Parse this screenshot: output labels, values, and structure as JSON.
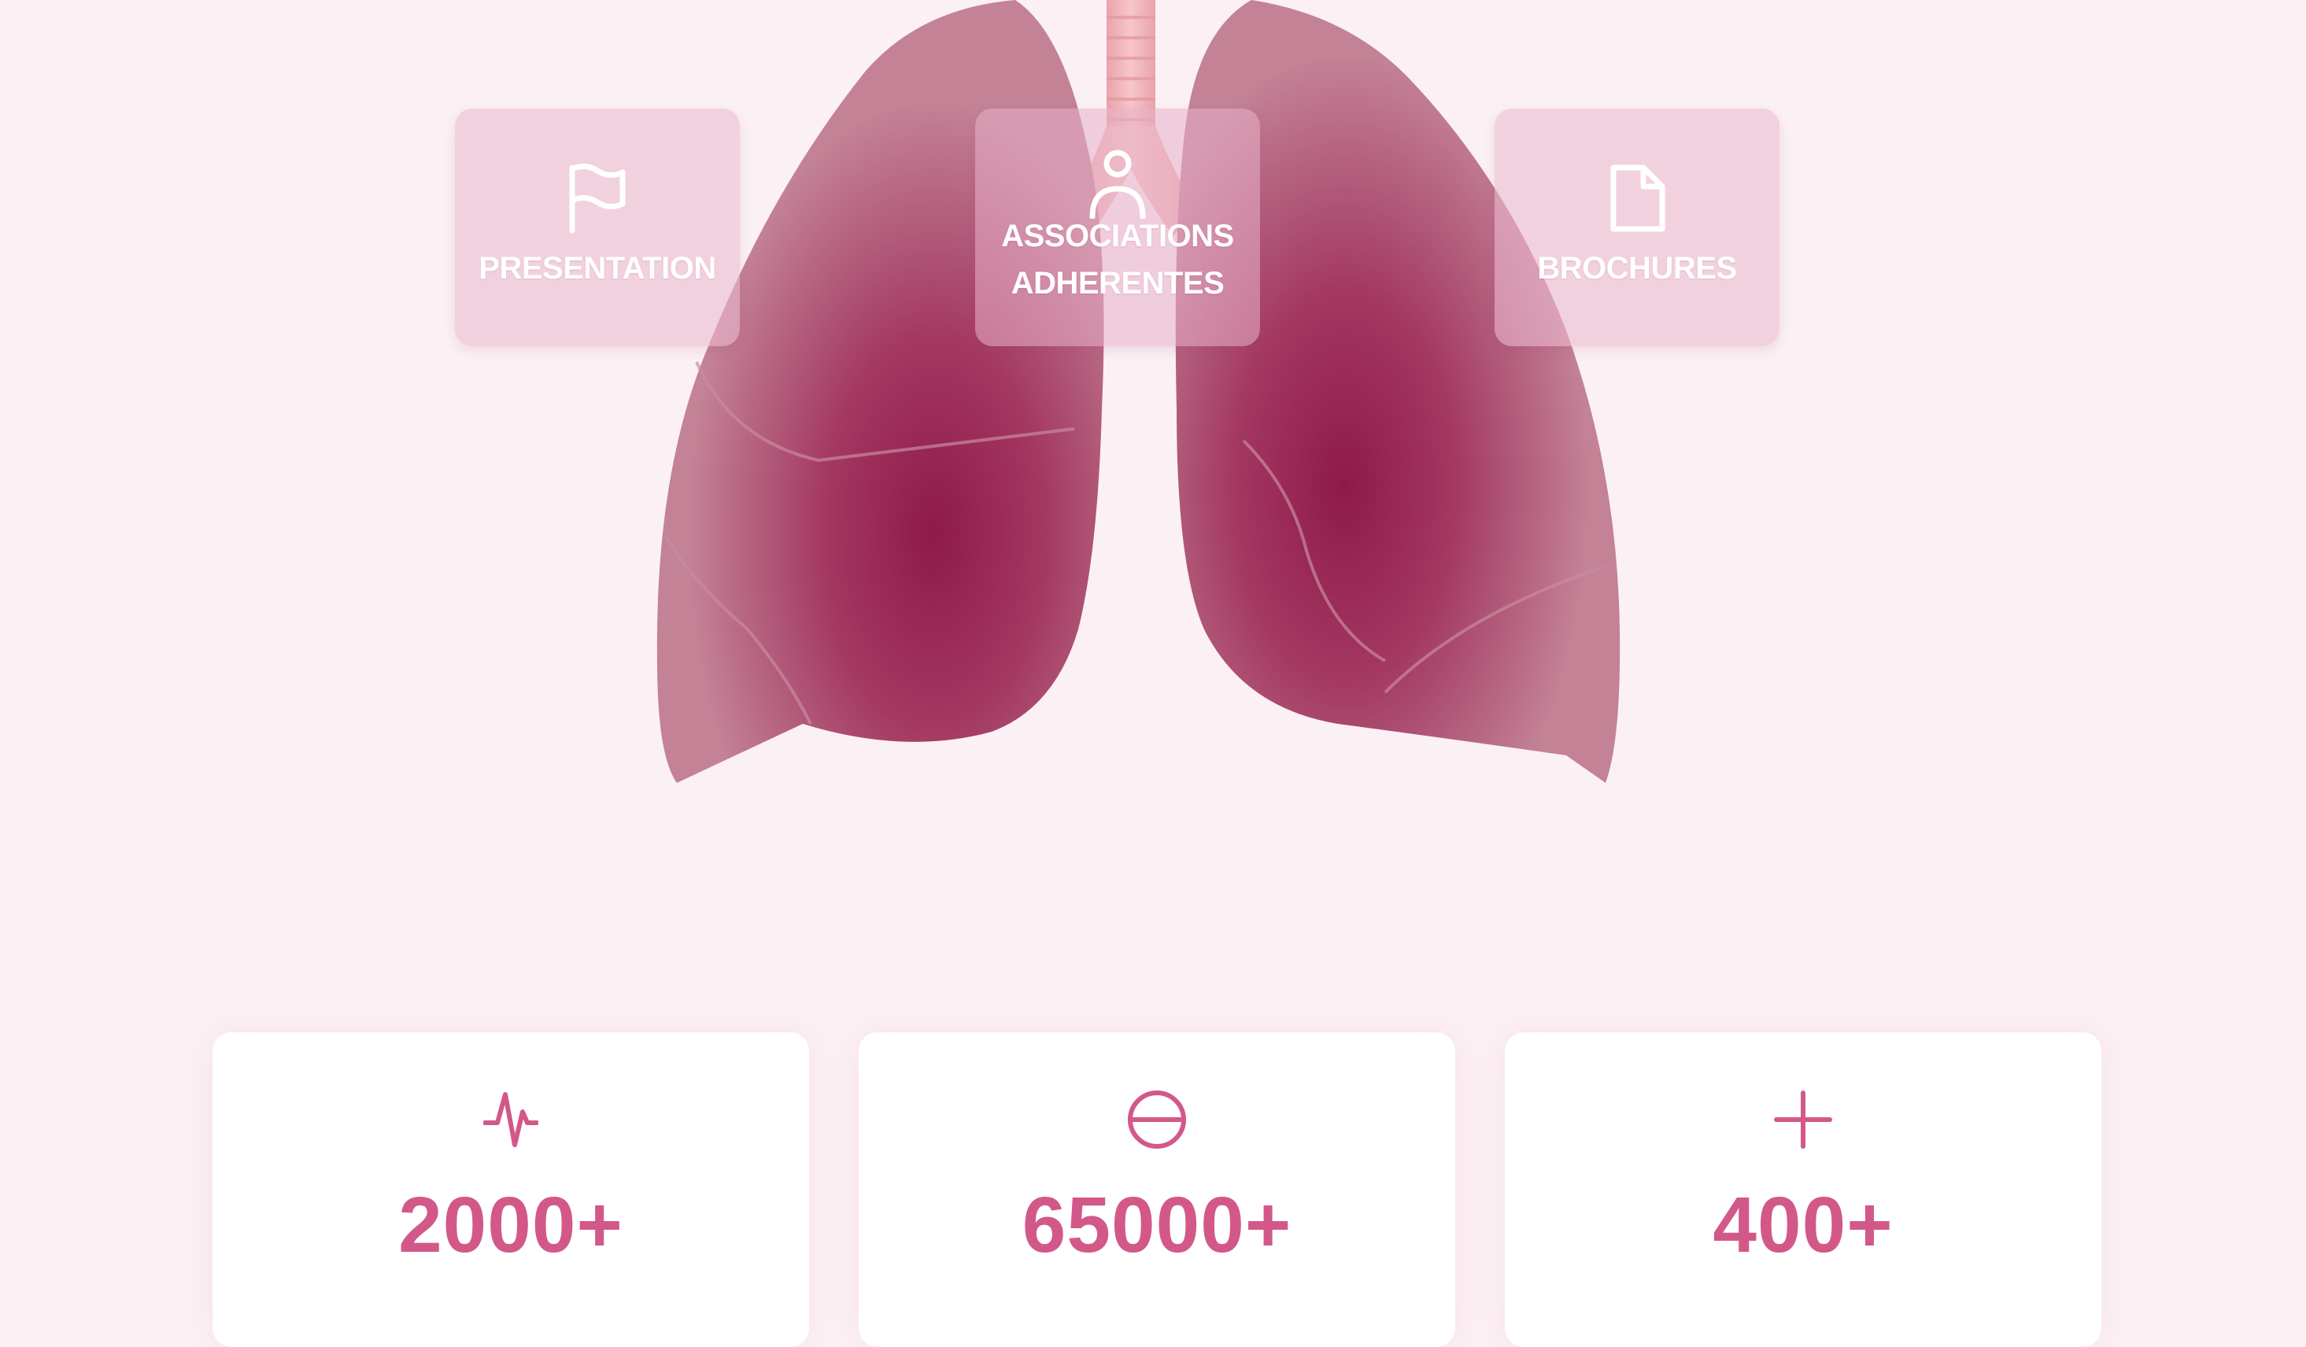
{
  "nav": {
    "items": [
      {
        "label": "PRESENTATION",
        "icon": "flag-icon"
      },
      {
        "label": "ASSOCIATIONS ADHERENTES",
        "icon": "user-icon"
      },
      {
        "label": "BROCHURES",
        "icon": "document-icon"
      }
    ]
  },
  "stats": [
    {
      "value": "2000+",
      "icon": "pulse-icon"
    },
    {
      "value": "65000+",
      "icon": "minus-circle-icon"
    },
    {
      "value": "400+",
      "icon": "plus-icon"
    }
  ],
  "colors": {
    "background": "#fbf0f4",
    "accent": "#d3588a",
    "lung": "#a8355f",
    "trachea": "#f2b4b8"
  }
}
